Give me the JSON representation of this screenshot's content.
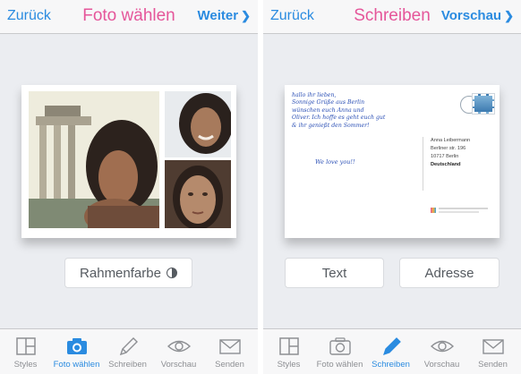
{
  "left_screen": {
    "nav": {
      "back": "Zurück",
      "title": "Foto wählen",
      "next": "Weiter",
      "next_chevron": "❯"
    },
    "frame_color_button": "Rahmenfarbe",
    "tabs": [
      {
        "label": "Styles",
        "icon": "styles-icon"
      },
      {
        "label": "Foto wählen",
        "icon": "camera-icon"
      },
      {
        "label": "Schreiben",
        "icon": "pencil-icon"
      },
      {
        "label": "Vorschau",
        "icon": "eye-icon"
      },
      {
        "label": "Senden",
        "icon": "envelope-icon"
      }
    ],
    "active_tab": "Foto wählen"
  },
  "right_screen": {
    "nav": {
      "back": "Zurück",
      "title": "Schreiben",
      "next": "Vorschau",
      "next_chevron": "❯"
    },
    "message_lines": [
      "hallo ihr lieben,",
      "Sonnige Grüße aus Berlin",
      "wünschen euch Anna und",
      "Oliver. Ich hoffe es geht euch gut",
      "& ihr genießt den Sommer!"
    ],
    "love_line": "We love you!!",
    "address": {
      "name": "Anna Leibermann",
      "street": "Berliner str. 196",
      "city": "10717 Berlin",
      "country": "Deutschland"
    },
    "text_button": "Text",
    "address_button": "Adresse",
    "tabs": [
      {
        "label": "Styles",
        "icon": "styles-icon"
      },
      {
        "label": "Foto wählen",
        "icon": "camera-icon"
      },
      {
        "label": "Schreiben",
        "icon": "pencil-icon"
      },
      {
        "label": "Vorschau",
        "icon": "eye-icon"
      },
      {
        "label": "Senden",
        "icon": "envelope-icon"
      }
    ],
    "active_tab": "Schreiben"
  },
  "colors": {
    "accent_blue": "#2a8be0",
    "title_pink": "#e5569a",
    "handwriting_blue": "#2a4fb5",
    "inactive_gray": "#8d8f93"
  }
}
